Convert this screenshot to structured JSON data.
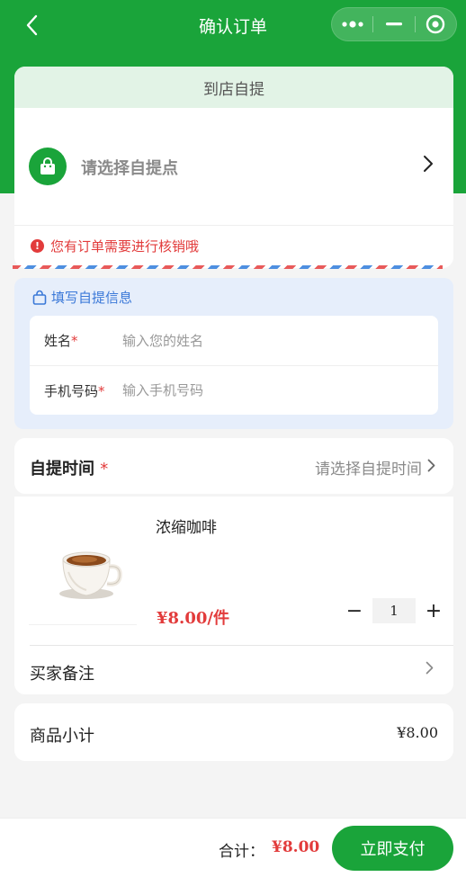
{
  "nav": {
    "title": "确认订单",
    "back_icon": "chevron-left-icon",
    "capsule": {
      "more_icon": "more-dots-icon",
      "minimize_icon": "minimize-icon",
      "close_icon": "target-circle-icon"
    }
  },
  "pickup": {
    "tab_label": "到店自提",
    "store_placeholder": "请选择自提点",
    "store_icon": "shopping-bag-icon",
    "warning_icon": "alert-icon",
    "warning_text": "您有订单需要进行核销哦"
  },
  "pickup_info": {
    "heading_icon": "lock-bag-icon",
    "heading": "填写自提信息",
    "name_label": "姓名",
    "name_placeholder": "输入您的姓名",
    "name_value": "",
    "phone_label": "手机号码",
    "phone_placeholder": "输入手机号码",
    "phone_value": "",
    "required_mark": "*"
  },
  "pickup_time": {
    "label": "自提时间",
    "required_mark": "*",
    "placeholder": "请选择自提时间"
  },
  "product": {
    "name": "浓缩咖啡",
    "image_icon": "coffee-cup-image",
    "price": "¥8.00/件",
    "quantity": "1",
    "minus": "−",
    "plus": "+"
  },
  "remark": {
    "label": "买家备注"
  },
  "subtotal": {
    "label": "商品小计",
    "value": "¥8.00"
  },
  "footer": {
    "total_label": "合计：",
    "total_value": "¥8.00",
    "pay_label": "立即支付"
  },
  "colors": {
    "brand": "#1aa43a",
    "price": "#e23b3b",
    "info_blue": "#3a78d8",
    "info_bg": "#e6eefb",
    "tab_bg": "#e2f3e6"
  }
}
